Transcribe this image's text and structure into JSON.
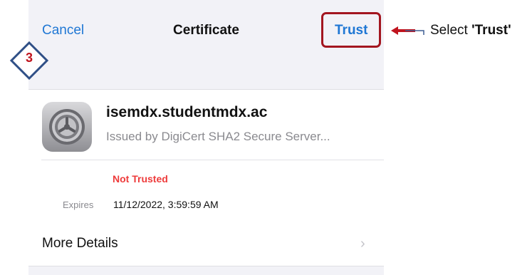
{
  "nav": {
    "cancel_label": "Cancel",
    "title": "Certificate",
    "trust_label": "Trust"
  },
  "annotation": {
    "step_number": "3",
    "callout_prefix": "Select",
    "callout_target": "'Trust'",
    "highlight_color": "#a31620"
  },
  "certificate": {
    "name": "isemdx.studentmdx.ac",
    "issuer": "Issued by DigiCert SHA2 Secure Server...",
    "icon": "gear-icon",
    "status": "Not Trusted",
    "status_color": "#ee3b3b",
    "expires_label": "Expires",
    "expires_value": "11/12/2022, 3:59:59 AM"
  },
  "details": {
    "more_label": "More Details",
    "chevron_icon": "chevron-right-icon"
  },
  "colors": {
    "accent": "#1f77d4",
    "background": "#f2f2f7"
  }
}
